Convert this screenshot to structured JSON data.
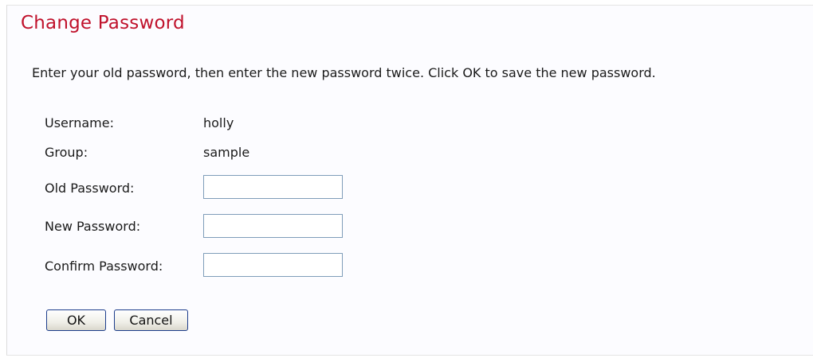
{
  "page": {
    "title": "Change Password",
    "instructions": "Enter your old password, then enter the new password twice. Click OK to save the new password."
  },
  "form": {
    "username_label": "Username:",
    "username_value": "holly",
    "group_label": "Group:",
    "group_value": "sample",
    "old_password_label": "Old Password:",
    "old_password_value": "",
    "new_password_label": "New Password:",
    "new_password_value": "",
    "confirm_password_label": "Confirm Password:",
    "confirm_password_value": ""
  },
  "buttons": {
    "ok_label": "OK",
    "cancel_label": "Cancel"
  },
  "colors": {
    "title": "#c0122c",
    "panel_background": "#fcfcff",
    "input_border": "#7f9db9",
    "button_border": "#1c3d8c"
  }
}
